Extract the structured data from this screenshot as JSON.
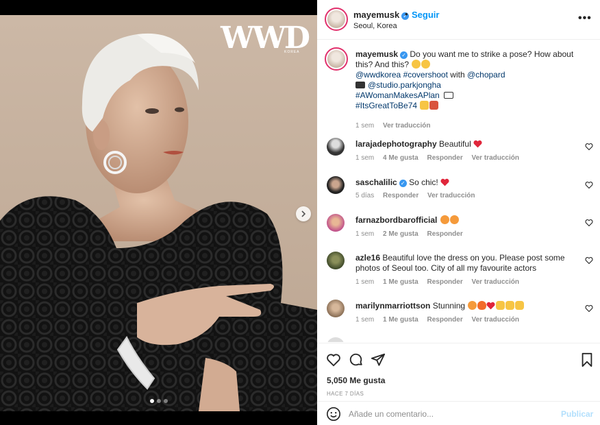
{
  "photo": {
    "logo": "WWD",
    "logo_sub": "KOREA",
    "carousel_total": 3,
    "carousel_index": 1
  },
  "header": {
    "username": "mayemusk",
    "separator": "•",
    "follow_label": "Seguir",
    "location": "Seoul, Korea"
  },
  "caption": {
    "username": "mayemusk",
    "text": "Do you want me to strike a pose? How about this? And this?",
    "line2_mention1": "@wwdkorea",
    "line2_tag": "#covershoot",
    "line2_with": "with",
    "line2_mention2": "@chopard",
    "line3_mention": "@studio.parkjongha",
    "line4_tag": "#AWomanMakesAPlan",
    "line5_tag": "#ItsGreatToBe74",
    "time": "1 sem",
    "translate": "Ver traducción"
  },
  "comments": [
    {
      "username": "larajadephotography",
      "verified": false,
      "text": "Beautiful",
      "time": "1 sem",
      "likes": "4 Me gusta",
      "reply": "Responder",
      "translate": "Ver traducción"
    },
    {
      "username": "saschalilic",
      "verified": true,
      "text": "So chic!",
      "time": "5 días",
      "likes": "",
      "reply": "Responder",
      "translate": "Ver traducción"
    },
    {
      "username": "farnazbordbarofficial",
      "verified": false,
      "text": "",
      "time": "1 sem",
      "likes": "2 Me gusta",
      "reply": "Responder",
      "translate": ""
    },
    {
      "username": "azle16",
      "verified": false,
      "text": "Beautiful love the dress on you. Please post some photos of Seoul too. City of all my favourite actors",
      "time": "1 sem",
      "likes": "1 Me gusta",
      "reply": "Responder",
      "translate": "Ver traducción"
    },
    {
      "username": "marilynmarriottson",
      "verified": false,
      "text": "Stunning",
      "time": "1 sem",
      "likes": "1 Me gusta",
      "reply": "Responder",
      "translate": "Ver traducción"
    }
  ],
  "footer": {
    "likes": "5,050 Me gusta",
    "ago": "HACE 7 DÍAS",
    "comment_placeholder": "Añade un comentario...",
    "publish_label": "Publicar"
  },
  "colors": {
    "accent": "#0095f6",
    "verified": "#3897f0",
    "heart": "#ed4956",
    "link": "#00376b",
    "muted": "#8e8e8e"
  },
  "icons": [
    "chevron-right-icon",
    "verified-icon",
    "more-icon",
    "heart-icon",
    "comment-icon",
    "share-icon",
    "bookmark-icon",
    "emoji-icon",
    "camera-icon"
  ]
}
